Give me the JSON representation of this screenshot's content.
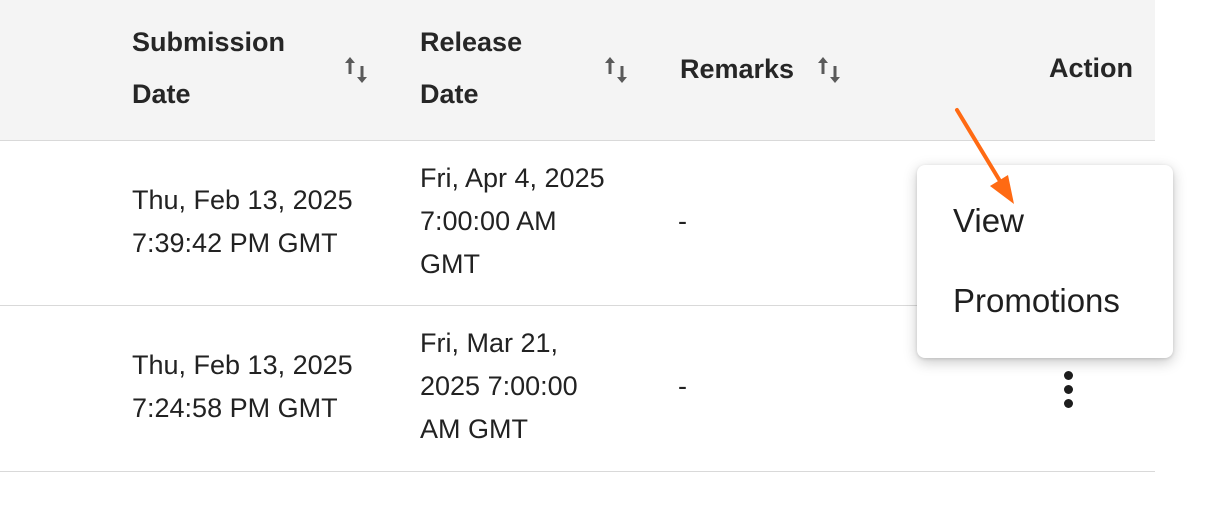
{
  "table": {
    "columns": [
      {
        "label_line1": "Submission",
        "label_line2": "Date",
        "sortable": true
      },
      {
        "label_line1": "Release",
        "label_line2": "Date",
        "sortable": true
      },
      {
        "label": "Remarks",
        "sortable": true
      },
      {
        "label": "Action",
        "sortable": false
      }
    ],
    "rows": [
      {
        "submission_line1": "Thu, Feb 13, 2025",
        "submission_line2": "7:39:42 PM GMT",
        "release_line1": "Fri, Apr 4, 2025",
        "release_line2": "7:00:00 AM",
        "release_line3": "GMT",
        "remarks": "-"
      },
      {
        "submission_line1": "Thu, Feb 13, 2025",
        "submission_line2": "7:24:58 PM GMT",
        "release_line1": "Fri, Mar 21,",
        "release_line2": "2025 7:00:00",
        "release_line3": "AM GMT",
        "remarks": "-"
      }
    ]
  },
  "action_menu": {
    "items": [
      "View",
      "Promotions"
    ]
  },
  "icons": {
    "sort": "sort-arrows-icon",
    "more": "more-vertical-icon",
    "annotation": "arrow-annotation"
  },
  "colors": {
    "header_bg": "#f4f4f4",
    "divider": "#d9d9d9",
    "annotation_arrow": "#ff6a13"
  }
}
